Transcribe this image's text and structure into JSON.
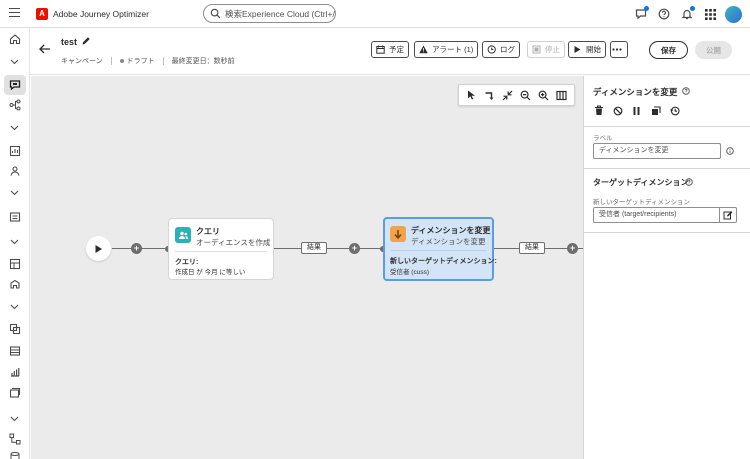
{
  "app": {
    "name": "Adobe Journey Optimizer",
    "logo_letter": "A",
    "search_placeholder": "検索Experience Cloud (Ctrl+/)"
  },
  "header": {
    "title": "test",
    "type": "キャンペーン",
    "status": "ドラフト",
    "last_modified": "最終変更日：数秒前",
    "buttons": {
      "schedule": "予定",
      "alerts": "アラート (1)",
      "log": "ログ",
      "stop": "停止",
      "start": "開始",
      "save": "保存",
      "publish": "公開"
    }
  },
  "canvas": {
    "nodes": {
      "query": {
        "title": "クエリ",
        "subtitle": "オーディエンスを作成",
        "label": "クエリ:",
        "value": "作成日 が 今月 に等しい"
      },
      "change_dimension": {
        "title": "ディメンションを変更",
        "subtitle": "ディメンションを変更",
        "label": "新しいターゲットディメンション:",
        "value": "受信者 (cuss)"
      }
    },
    "transitions": [
      "結果",
      "結果"
    ]
  },
  "panel": {
    "title": "ディメンションを変更",
    "label_caption": "ラベル",
    "label_value": "ディメンションを変更",
    "section_title": "ターゲットディメンション",
    "target_caption": "新しいターゲットディメンション",
    "target_value": "受信者 (target/recipients)"
  },
  "colors": {
    "accent": "#1473e6",
    "selected_node_bg": "#d3e4f7",
    "selected_node_border": "#5b9ce8",
    "query_icon_bg": "#2ab1b9",
    "dimension_icon_bg": "#f0a34b",
    "adobe_red": "#eb1000"
  }
}
